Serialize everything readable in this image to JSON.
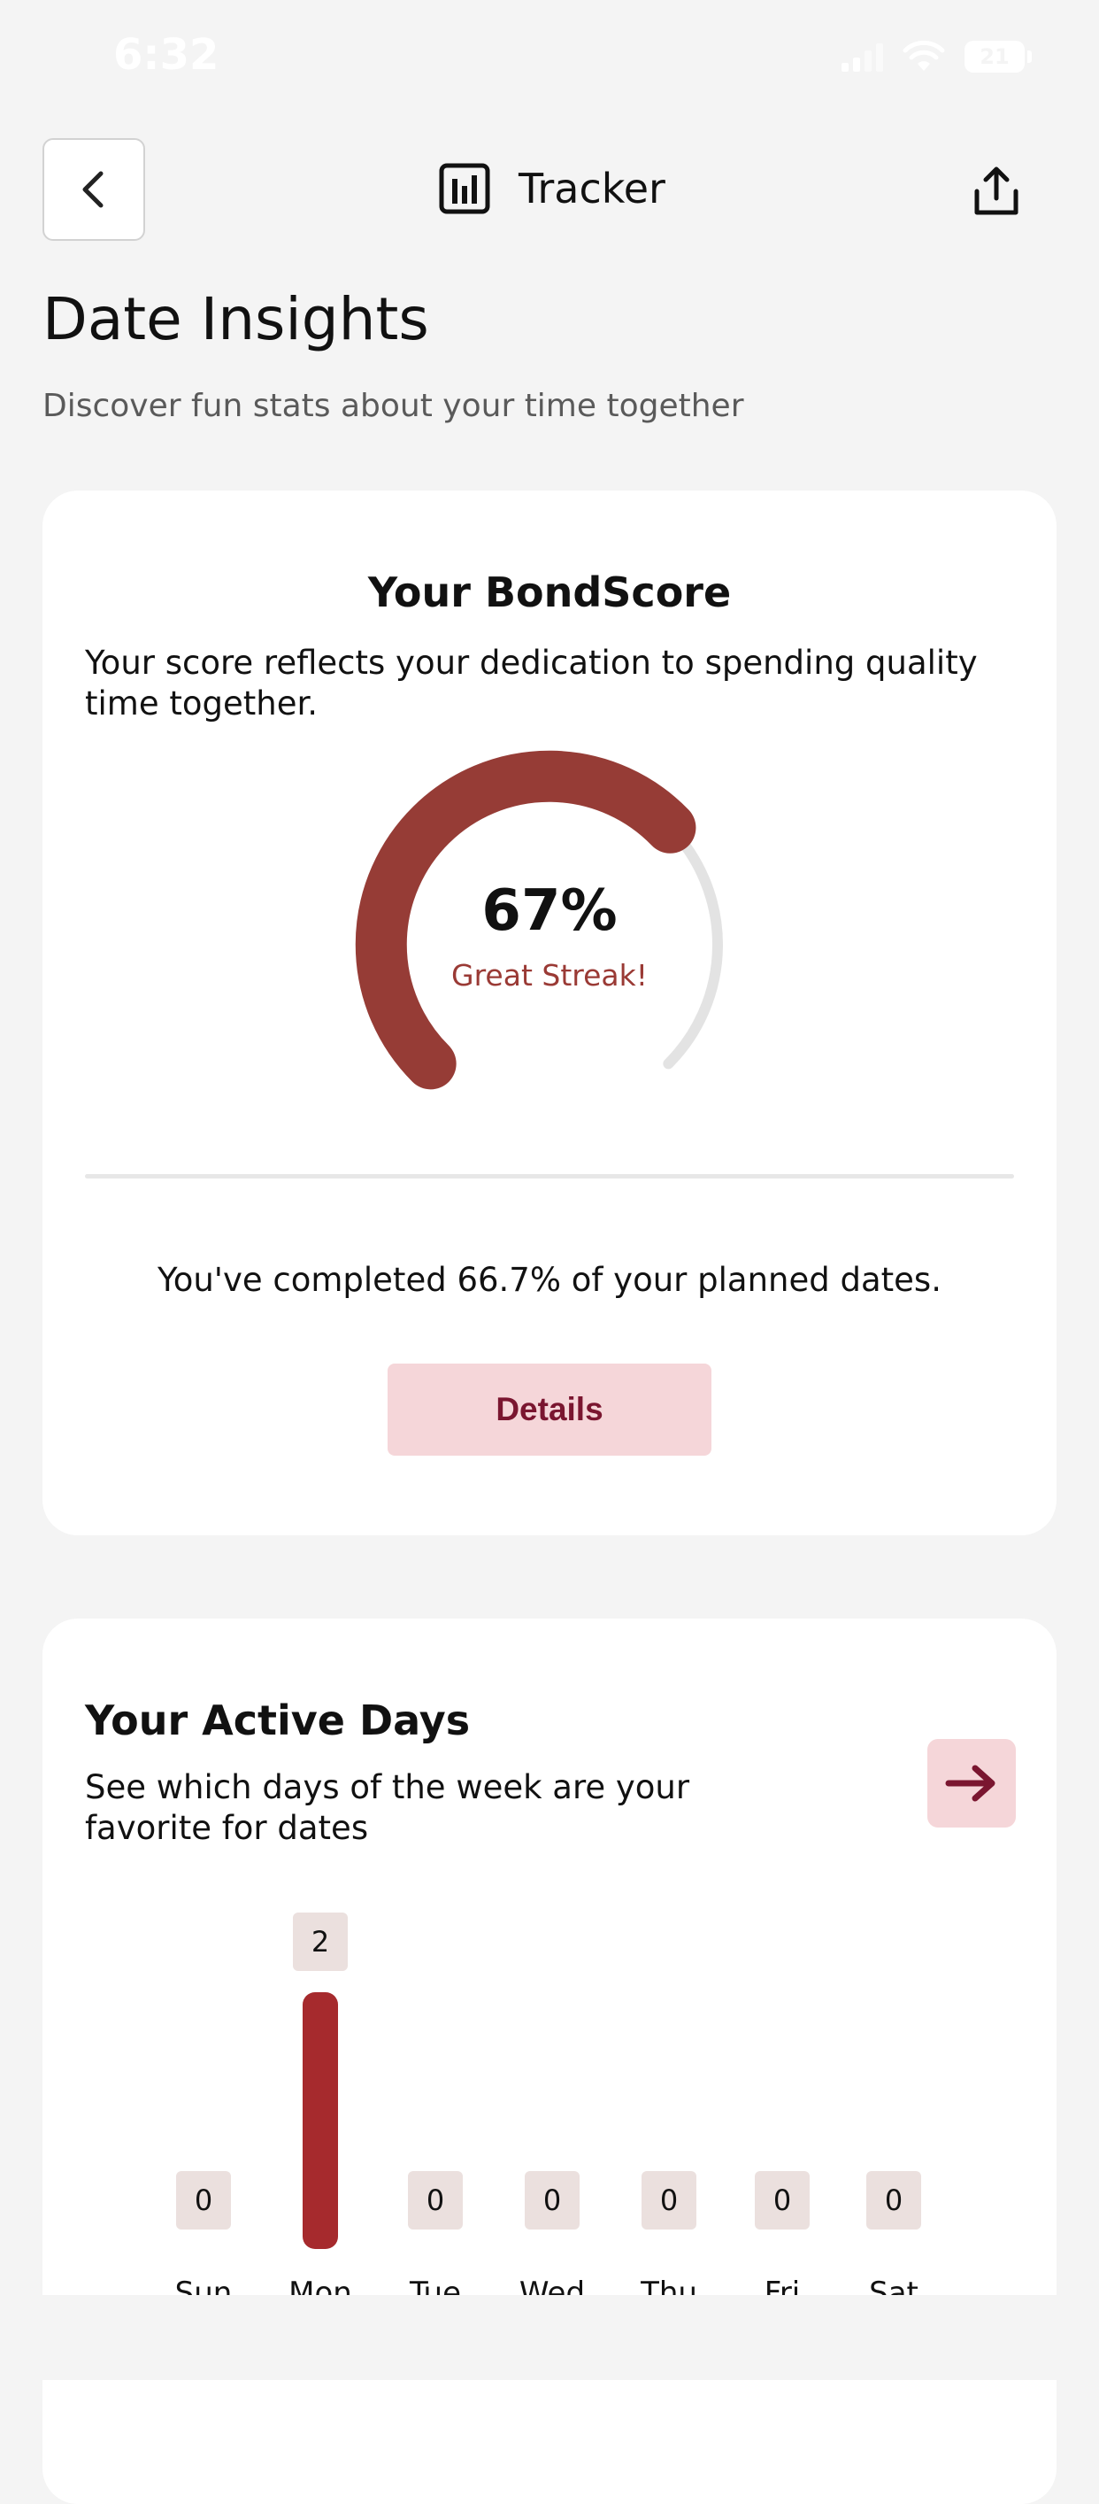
{
  "status_bar": {
    "time": "6:32",
    "battery": "21"
  },
  "nav": {
    "title": "Tracker"
  },
  "page": {
    "title": "Date Insights",
    "subtitle": "Discover fun stats about your time together"
  },
  "bond_card": {
    "title": "Your BondScore",
    "description": "Your score reflects your dedication to spending quality time together.",
    "score_text": "67%",
    "score_fraction": 0.67,
    "score_label": "Great Streak!",
    "completion_text": "You've completed 66.7% of your planned dates.",
    "details_label": "Details"
  },
  "days_card": {
    "title": "Your Active Days",
    "description": "See which days of the week are your favorite for dates"
  },
  "colors": {
    "accent": "#963c36",
    "track": "#e3e3e3",
    "bar": "#a62a2d",
    "button_bg": "#f5d6d9",
    "button_text": "#7a1630"
  },
  "chart_data": {
    "type": "bar",
    "categories": [
      "Sun",
      "Mon",
      "Tue",
      "Wed",
      "Thu",
      "Fri",
      "Sat"
    ],
    "values": [
      0,
      2,
      0,
      0,
      0,
      0,
      0
    ]
  }
}
